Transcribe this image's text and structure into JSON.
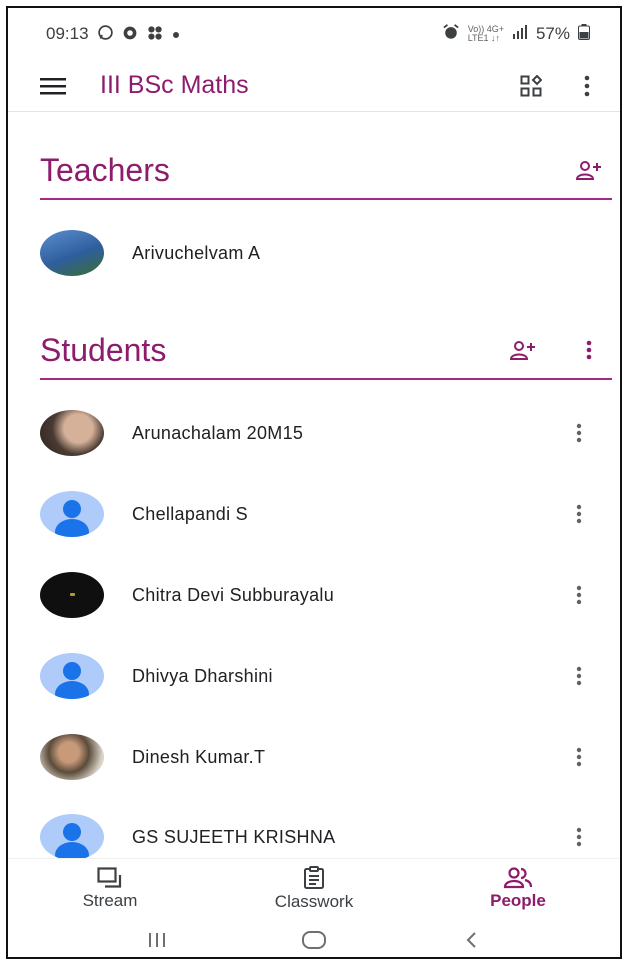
{
  "status_bar": {
    "time": "09:13",
    "network_top": "Vo)) 4G+",
    "network_bottom": "LTE1 ↓↑",
    "battery": "57%"
  },
  "app_bar": {
    "title": "III BSc Maths"
  },
  "teachers": {
    "heading": "Teachers",
    "items": [
      {
        "name": "Arivuchelvam A"
      }
    ]
  },
  "students": {
    "heading": "Students",
    "items": [
      {
        "name": "Arunachalam 20M15"
      },
      {
        "name": "Chellapandi S"
      },
      {
        "name": "Chitra Devi Subburayalu"
      },
      {
        "name": "Dhivya Dharshini"
      },
      {
        "name": "Dinesh Kumar.T"
      },
      {
        "name": "GS SUJEETH KRISHNA"
      }
    ]
  },
  "bottom_nav": {
    "tabs": [
      {
        "label": "Stream"
      },
      {
        "label": "Classwork"
      },
      {
        "label": "People",
        "active": true
      }
    ]
  },
  "colors": {
    "accent": "#8e1c6d",
    "divider": "#a12a83",
    "avatar_bg": "#aecbfa",
    "avatar_fg": "#1a73e8"
  }
}
